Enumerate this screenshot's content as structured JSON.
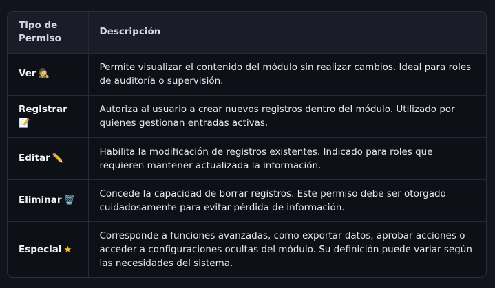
{
  "table": {
    "headers": [
      "Tipo de Permiso",
      "Descripción"
    ],
    "rows": [
      {
        "permission": "Ver",
        "emoji": "🕵️",
        "description": "Permite visualizar el contenido del módulo sin realizar cambios. Ideal para roles de auditoría o supervisión."
      },
      {
        "permission": "Registrar",
        "emoji": "📝",
        "description": "Autoriza al usuario a crear nuevos registros dentro del módulo. Utilizado por quienes gestionan entradas activas."
      },
      {
        "permission": "Editar",
        "emoji": "✏️",
        "description": "Habilita la modificación de registros existentes. Indicado para roles que requieren mantener actualizada la información."
      },
      {
        "permission": "Eliminar",
        "emoji": "🗑️",
        "description": "Concede la capacidad de borrar registros. Este permiso debe ser otorgado cuidadosamente para evitar pérdida de información."
      },
      {
        "permission": "Especial",
        "emoji": "★",
        "description": "Corresponde a funciones avanzadas, como exportar datos, aprobar acciones o acceder a configuraciones ocultas del módulo. Su definición puede variar según las necesidades del sistema."
      }
    ]
  },
  "colors": {
    "background": "#12141d",
    "header_background": "#1a1d28",
    "border": "#262a35",
    "star": "#f5c518"
  }
}
